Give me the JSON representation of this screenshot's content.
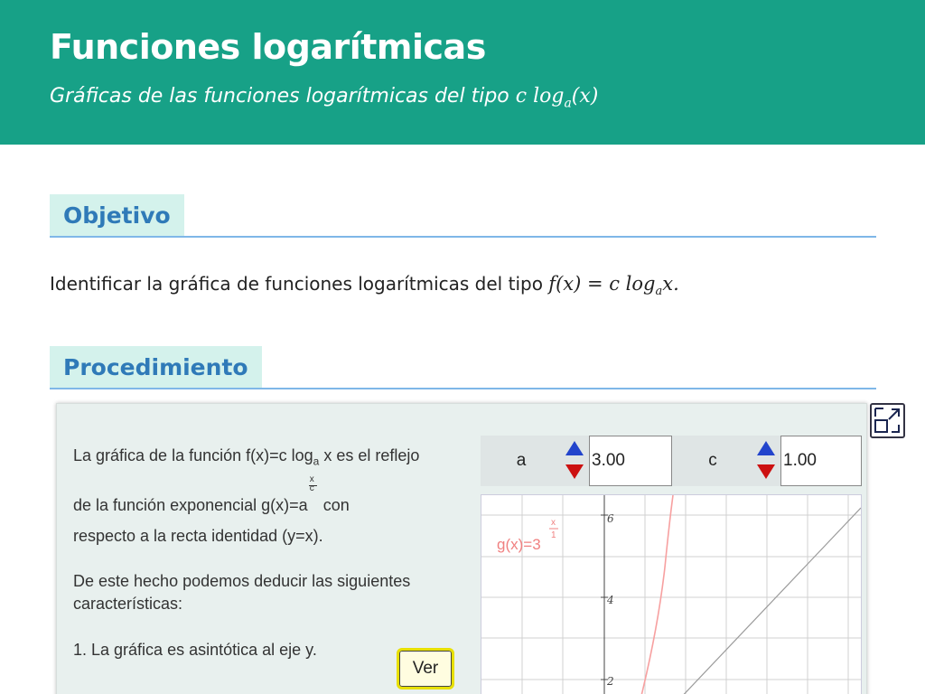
{
  "header": {
    "title": "Funciones logarítmicas",
    "subtitle_prefix": "Gráficas de las funciones logarítmicas del tipo",
    "subtitle_math_c": "c log",
    "subtitle_math_sub": "a",
    "subtitle_math_arg": "(x)"
  },
  "objetivo": {
    "heading": "Objetivo",
    "text": "Identificar la gráfica de funciones logarítmicas del tipo",
    "math_main": "f(x) = c log",
    "math_sub": "a",
    "math_end": "x."
  },
  "procedimiento": {
    "heading": "Procedimiento"
  },
  "applet": {
    "line1_a": "La gráfica de la función f(x)=c log",
    "line1_sub": "a",
    "line1_b": " x es el reflejo",
    "line2_a": "de la función exponencial g(x)=a",
    "line2_num": "x",
    "line2_den": "c",
    "line2_b": " con",
    "line3": "respecto a la recta identidad (y=x).",
    "line4": "De este hecho podemos deducir las siguientes",
    "line5": "características:",
    "line6": "1. La gráfica es asintótica al eje y.",
    "ver_label": "Ver",
    "param_a_label": "a",
    "param_a_value": "3.00",
    "param_c_label": "c",
    "param_c_value": "1.00",
    "graph_label_main": "g(x)=3",
    "graph_label_num": "x",
    "graph_label_den": "1",
    "y_ticks": [
      "6",
      "4",
      "2"
    ],
    "colors": {
      "exp_curve": "#f7a0a0",
      "identity_line": "#9a9a9a",
      "grid": "#d0d0d0"
    }
  }
}
